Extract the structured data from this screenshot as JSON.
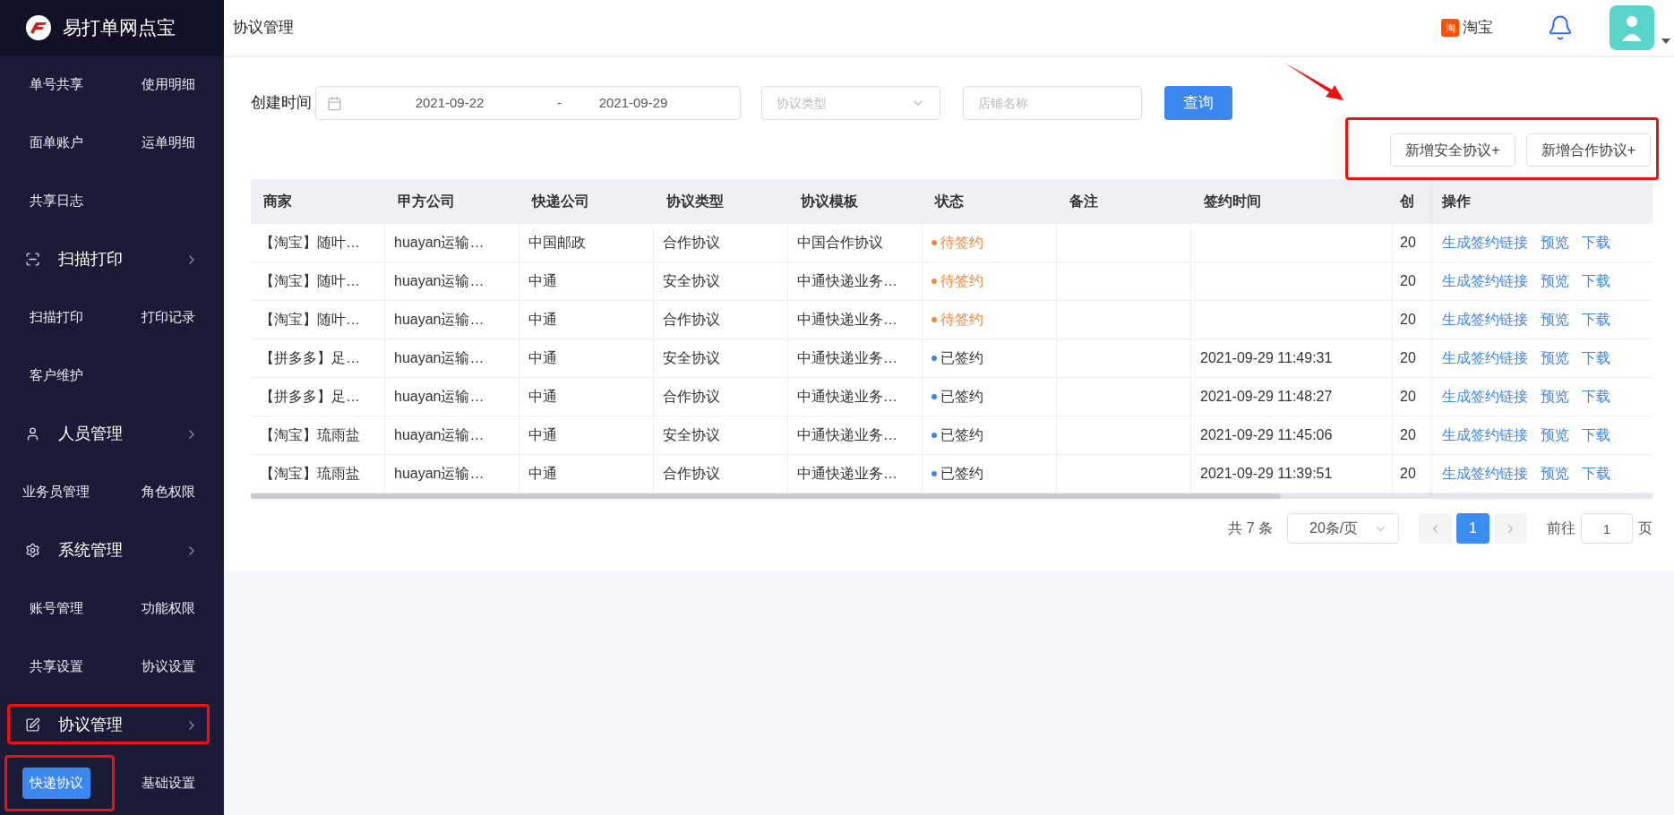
{
  "app": {
    "name": "易打单网点宝"
  },
  "sidebar": {
    "groups": [
      {
        "items": [
          {
            "label": "单号共享",
            "selected": false
          },
          {
            "label": "使用明细",
            "selected": false
          },
          {
            "label": "面单账户",
            "selected": false
          },
          {
            "label": "运单明细",
            "selected": false
          },
          {
            "label": "共享日志",
            "selected": false
          }
        ]
      },
      {
        "header": {
          "label": "扫描打印",
          "expanded": true
        },
        "items": [
          {
            "label": "扫描打印",
            "selected": false
          },
          {
            "label": "打印记录",
            "selected": false
          },
          {
            "label": "客户维护",
            "selected": false
          }
        ]
      },
      {
        "header": {
          "label": "人员管理",
          "expanded": true
        },
        "items": [
          {
            "label": "业务员管理",
            "selected": false
          },
          {
            "label": "角色权限",
            "selected": false
          }
        ]
      },
      {
        "header": {
          "label": "系统管理",
          "expanded": true
        },
        "items": [
          {
            "label": "账号管理",
            "selected": false
          },
          {
            "label": "功能权限",
            "selected": false
          },
          {
            "label": "共享设置",
            "selected": false
          },
          {
            "label": "协议设置",
            "selected": false
          }
        ]
      },
      {
        "header": {
          "label": "协议管理",
          "expanded": true
        },
        "items": [
          {
            "label": "快递协议",
            "selected": true
          },
          {
            "label": "基础设置",
            "selected": false
          }
        ]
      }
    ]
  },
  "topbar": {
    "title": "协议管理",
    "shop_badge": "淘",
    "shop": "淘宝"
  },
  "filters": {
    "date_label": "创建时间",
    "date_from": "2021-09-22",
    "date_sep": "-",
    "date_to": "2021-09-29",
    "type_placeholder": "协议类型",
    "shop_placeholder": "店铺名称",
    "query_button": "查询"
  },
  "actions": [
    "新增安全协议+",
    "新增合作协议+"
  ],
  "table": {
    "columns": [
      "商家",
      "甲方公司",
      "快递公司",
      "协议类型",
      "协议模板",
      "状态",
      "备注",
      "签约时间",
      "创",
      "操作"
    ],
    "rows": [
      {
        "cells": [
          "【淘宝】随叶…",
          "huayan运输…",
          "中国邮政",
          "合作协议",
          "中国合作协议"
        ],
        "status": {
          "text": "待签约",
          "kind": "pending"
        },
        "column_9": "20",
        "links": [
          "生成签约链接",
          "预览",
          "下载"
        ]
      },
      {
        "cells": [
          "【淘宝】随叶…",
          "huayan运输…",
          "中通",
          "安全协议",
          "中通快递业务…"
        ],
        "status": {
          "text": "待签约",
          "kind": "pending"
        },
        "column_9": "20",
        "links": [
          "生成签约链接",
          "预览",
          "下载"
        ]
      },
      {
        "cells": [
          "【淘宝】随叶…",
          "huayan运输…",
          "中通",
          "合作协议",
          "中通快递业务…"
        ],
        "status": {
          "text": "待签约",
          "kind": "pending"
        },
        "column_9": "20",
        "links": [
          "生成签约链接",
          "预览",
          "下载"
        ]
      },
      {
        "cells": [
          "【拼多多】足…",
          "huayan运输…",
          "中通",
          "安全协议",
          "中通快递业务…"
        ],
        "status": {
          "text": "已签约",
          "kind": "signed"
        },
        "signed_at": "2021-09-29 11:49:31",
        "column_9": "20",
        "links": [
          "生成签约链接",
          "预览",
          "下载"
        ]
      },
      {
        "cells": [
          "【拼多多】足…",
          "huayan运输…",
          "中通",
          "合作协议",
          "中通快递业务…"
        ],
        "status": {
          "text": "已签约",
          "kind": "signed"
        },
        "signed_at": "2021-09-29 11:48:27",
        "column_9": "20",
        "links": [
          "生成签约链接",
          "预览",
          "下载"
        ]
      },
      {
        "cells": [
          "【淘宝】琉雨盐",
          "huayan运输…",
          "中通",
          "安全协议",
          "中通快递业务…"
        ],
        "status": {
          "text": "已签约",
          "kind": "signed"
        },
        "signed_at": "2021-09-29 11:45:06",
        "column_9": "20",
        "links": [
          "生成签约链接",
          "预览",
          "下载"
        ]
      },
      {
        "cells": [
          "【淘宝】琉雨盐",
          "huayan运输…",
          "中通",
          "合作协议",
          "中通快递业务…"
        ],
        "status": {
          "text": "已签约",
          "kind": "signed"
        },
        "signed_at": "2021-09-29 11:39:51",
        "column_9": "20",
        "links": [
          "生成签约链接",
          "预览",
          "下载"
        ]
      }
    ]
  },
  "pagination": {
    "total": "共 7 条",
    "page_size": "20条/页",
    "pages": [
      {
        "label": "1",
        "selected": true
      }
    ],
    "goto_label": "前往",
    "goto_value": "1",
    "goto_suffix": "页"
  }
}
